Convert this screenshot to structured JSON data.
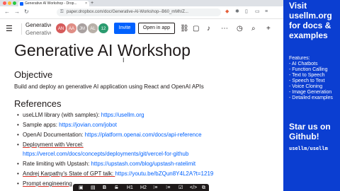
{
  "browser": {
    "tab_title": "Generative AI Workshop - Drop...",
    "tab_close": "×",
    "new_tab": "+",
    "url": "paper.dropbox.com/doc/Generative-AI-Workshop--B60_mMh/Z...",
    "nav": {
      "back": "←",
      "forward": "→",
      "reload": "↻"
    }
  },
  "doc_toolbar": {
    "menu_glyph": "☰",
    "title": "Generative AI Workshop",
    "subtitle": "Generative",
    "avatars": [
      {
        "initials": "AN",
        "color": "#d65b5b"
      },
      {
        "initials": "AA",
        "color": "#e08e86"
      },
      {
        "initials": "JM",
        "color": "#a9a1a0"
      },
      {
        "initials": "AL",
        "color": "#b8b0a8"
      },
      {
        "initials": "12",
        "color": "#2b9b6f"
      }
    ],
    "invite_label": "Invite",
    "open_app_label": "Open in app"
  },
  "document": {
    "title": "Generative AI Workshop",
    "objective_heading": "Objective",
    "objective_text": "Build and deploy an generative AI application using React and OpenAI APIs",
    "references_heading": "References",
    "references": [
      {
        "text": "useLLM library (with samples): ",
        "link": "https://usellm.org"
      },
      {
        "text": "Sample apps: ",
        "link": "https://jovian.com/jobot"
      },
      {
        "text": "OpenAI Documentation: ",
        "link": "https://platform.openai.com/docs/api-reference"
      },
      {
        "text": "Deployment with Vercel:",
        "link": ""
      },
      {
        "text": "",
        "link": "https://vercel.com/docs/concepts/deployments/git/vercel-for-github"
      },
      {
        "text": "Rate limiting with Upstash: ",
        "link": "https://upstash.com/blog/upstash-ratelimit"
      },
      {
        "text": "Andrej Karpathy's State of GPT talk: ",
        "link": "https://youtu.be/bZQun8Y4L2A?t=1219"
      },
      {
        "text": "Prompt engineering",
        "link": ""
      }
    ]
  },
  "format_toolbar": {
    "buttons": [
      "▣",
      "▤",
      "B",
      "S",
      "H1",
      "H2",
      "⁝≡",
      "⁝≡",
      "☑",
      "</>",
      "⧉"
    ]
  },
  "sidebar": {
    "headline": "Visit usellm.org for docs & examples",
    "features_label": "Features:",
    "features": [
      "- AI Chatbots",
      "- Function Calling",
      "- Text to Speech",
      "- Speech to Text",
      "- Voice Cloning",
      "- Image Generation",
      "- Detailed examples"
    ],
    "github_cta": "Star us on Github!",
    "github_handle": "usellm/usellm"
  },
  "colors": {
    "sidebar_bg": "#0b3ed1",
    "link": "#0061fe",
    "invite_bg": "#0061fe"
  }
}
